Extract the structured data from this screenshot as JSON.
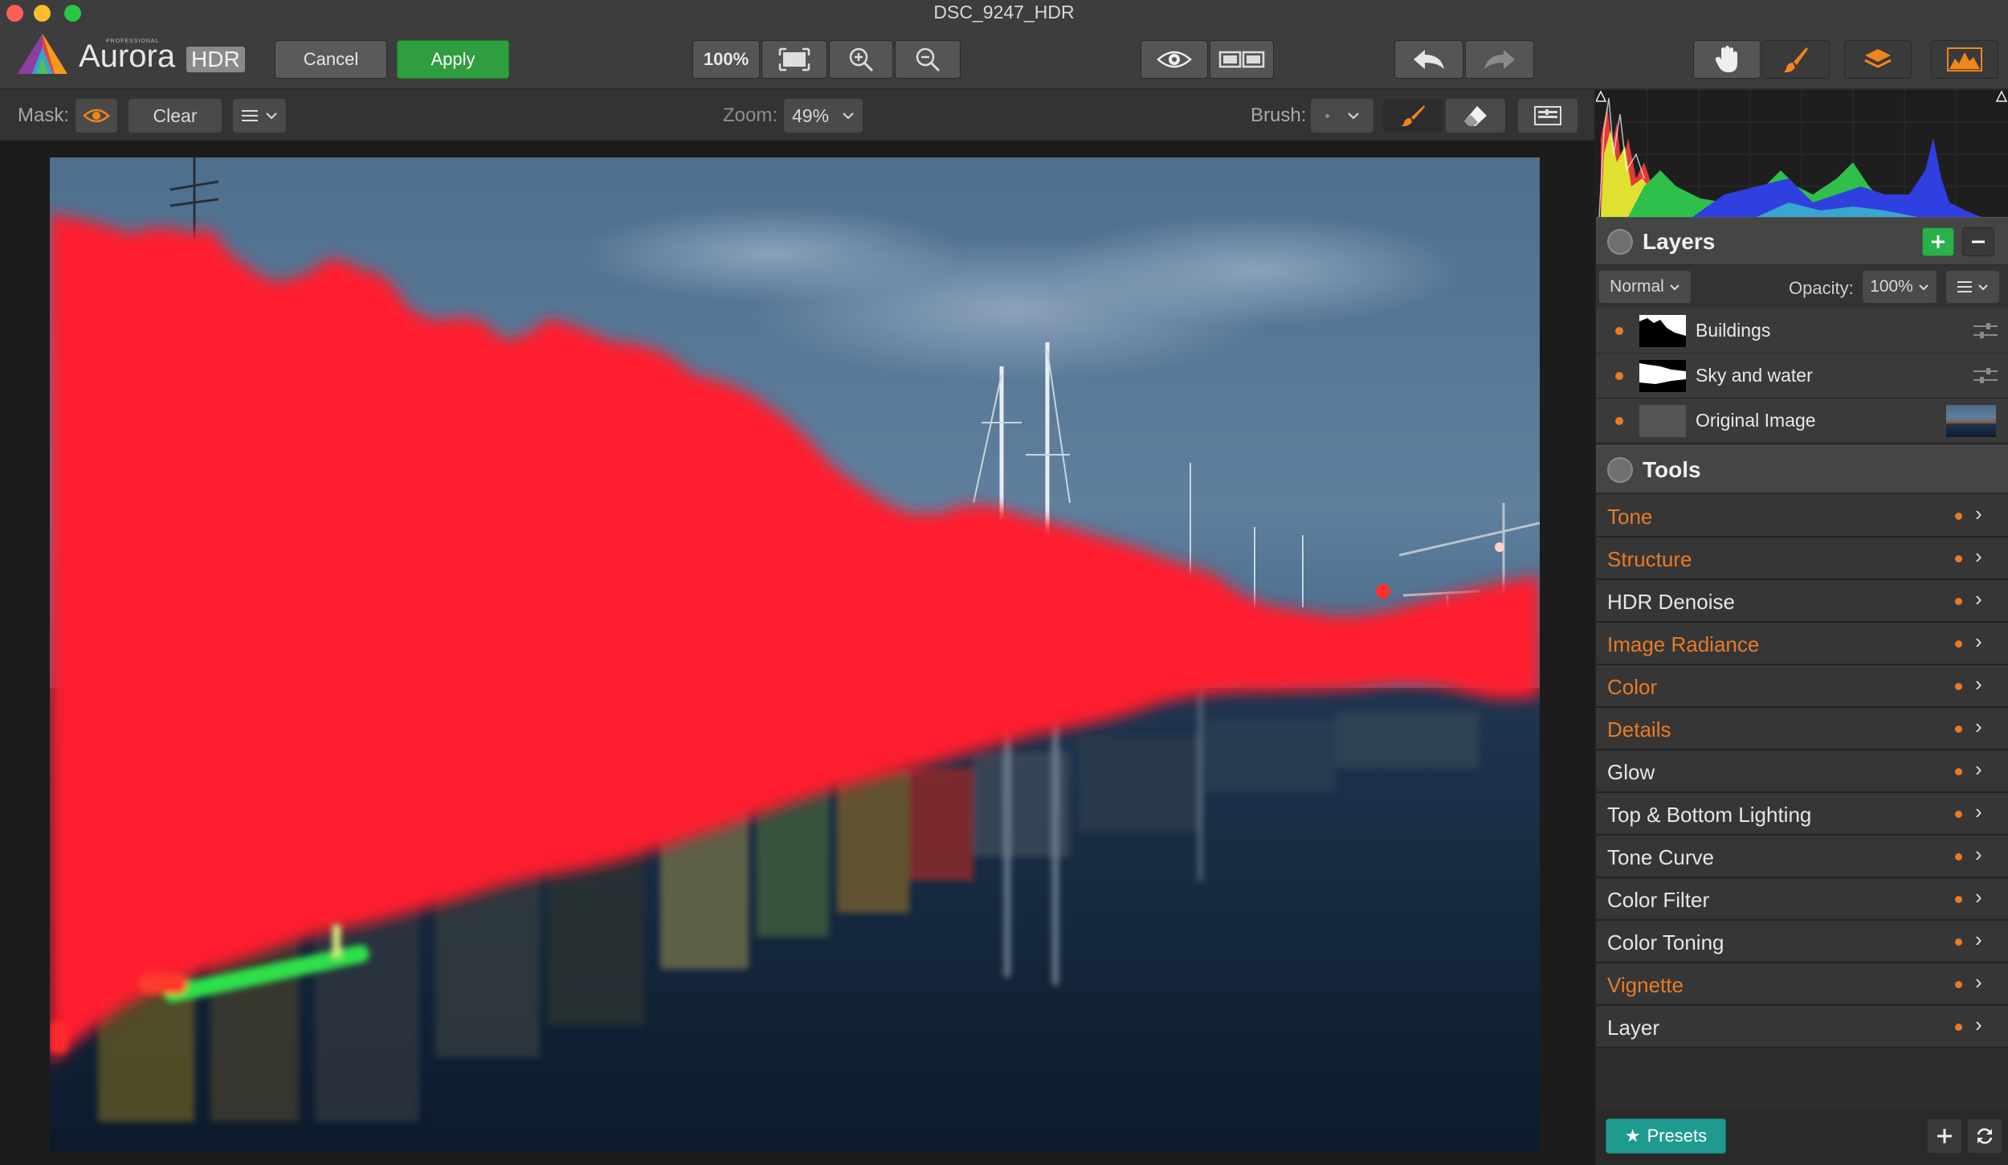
{
  "window": {
    "title": "DSC_9247_HDR"
  },
  "brand": {
    "small_label": "PROFESSIONAL",
    "name": "Aurora",
    "badge": "HDR"
  },
  "toolbar": {
    "cancel_label": "Cancel",
    "apply_label": "Apply",
    "zoom_percent": "100%"
  },
  "mask_bar": {
    "mask_label": "Mask:",
    "clear_label": "Clear",
    "zoom_label": "Zoom:",
    "zoom_value": "49%",
    "brush_label": "Brush:"
  },
  "layers": {
    "title": "Layers",
    "blend_mode": "Normal",
    "opacity_label": "Opacity:",
    "opacity_value": "100%",
    "items": [
      {
        "name": "Buildings"
      },
      {
        "name": "Sky and water"
      },
      {
        "name": "Original Image"
      }
    ]
  },
  "tools": {
    "title": "Tools",
    "items": [
      {
        "name": "Tone",
        "active": true
      },
      {
        "name": "Structure",
        "active": true
      },
      {
        "name": "HDR Denoise",
        "active": false
      },
      {
        "name": "Image Radiance",
        "active": true
      },
      {
        "name": "Color",
        "active": true
      },
      {
        "name": "Details",
        "active": true
      },
      {
        "name": "Glow",
        "active": false
      },
      {
        "name": "Top & Bottom Lighting",
        "active": false
      },
      {
        "name": "Tone Curve",
        "active": false
      },
      {
        "name": "Color Filter",
        "active": false
      },
      {
        "name": "Color Toning",
        "active": false
      },
      {
        "name": "Vignette",
        "active": true
      },
      {
        "name": "Layer",
        "active": false
      }
    ]
  },
  "presets": {
    "label": "Presets"
  },
  "colors": {
    "accent_orange": "#e87b27",
    "apply_green": "#2e9e3e",
    "presets_teal": "#1f9a8f",
    "add_green": "#2bb04a",
    "mask_red": "#ff1a2e"
  }
}
